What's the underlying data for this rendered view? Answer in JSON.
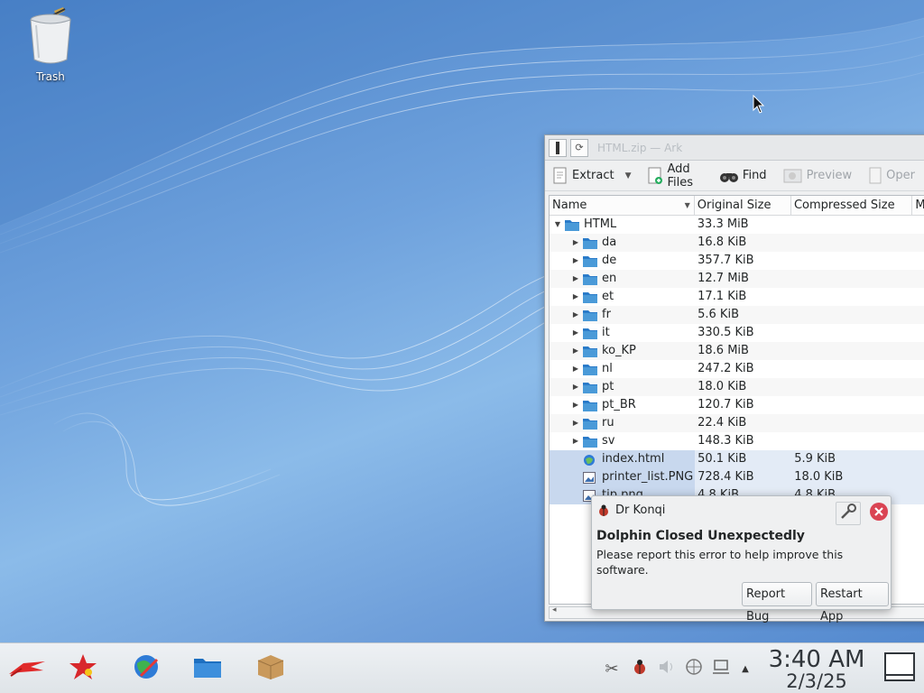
{
  "desktop": {
    "trash_label": "Trash"
  },
  "ark": {
    "title": "HTML.zip — Ark",
    "toolbar": {
      "extract": "Extract",
      "add_files": "Add Files",
      "find": "Find",
      "preview": "Preview",
      "open": "Oper"
    },
    "columns": [
      "Name",
      "Original Size",
      "Compressed Size",
      "M"
    ],
    "rows": [
      {
        "name": "HTML",
        "size": "33.3 MiB",
        "compressed": "",
        "mod": "",
        "type": "root"
      },
      {
        "name": "da",
        "size": "16.8 KiB",
        "compressed": "",
        "mod": "",
        "type": "folder"
      },
      {
        "name": "de",
        "size": "357.7 KiB",
        "compressed": "",
        "mod": "",
        "type": "folder"
      },
      {
        "name": "en",
        "size": "12.7 MiB",
        "compressed": "",
        "mod": "",
        "type": "folder"
      },
      {
        "name": "et",
        "size": "17.1 KiB",
        "compressed": "",
        "mod": "",
        "type": "folder"
      },
      {
        "name": "fr",
        "size": "5.6 KiB",
        "compressed": "",
        "mod": "",
        "type": "folder"
      },
      {
        "name": "it",
        "size": "330.5 KiB",
        "compressed": "",
        "mod": "",
        "type": "folder"
      },
      {
        "name": "ko_KP",
        "size": "18.6 MiB",
        "compressed": "",
        "mod": "",
        "type": "folder"
      },
      {
        "name": "nl",
        "size": "247.2 KiB",
        "compressed": "",
        "mod": "",
        "type": "folder"
      },
      {
        "name": "pt",
        "size": "18.0 KiB",
        "compressed": "",
        "mod": "",
        "type": "folder"
      },
      {
        "name": "pt_BR",
        "size": "120.7 KiB",
        "compressed": "",
        "mod": "",
        "type": "folder"
      },
      {
        "name": "ru",
        "size": "22.4 KiB",
        "compressed": "",
        "mod": "",
        "type": "folder"
      },
      {
        "name": "sv",
        "size": "148.3 KiB",
        "compressed": "",
        "mod": "",
        "type": "folder"
      },
      {
        "name": "index.html",
        "size": "50.1 KiB",
        "compressed": "5.9 KiB",
        "mod": "",
        "type": "html"
      },
      {
        "name": "printer_list.PNG",
        "size": "728.4 KiB",
        "compressed": "18.0 KiB",
        "mod": "",
        "type": "image"
      },
      {
        "name": "tip.png",
        "size": "4.8 KiB",
        "compressed": "4.8 KiB",
        "mod": "",
        "type": "image"
      }
    ]
  },
  "notification": {
    "app": "Dr Konqi",
    "title": "Dolphin Closed Unexpectedly",
    "body": "Please report this error to help improve this software.",
    "report_button": "Report Bug",
    "restart_button": "Restart App"
  },
  "taskbar": {
    "time": "3:40 AM",
    "date": "2/3/25"
  },
  "colors": {
    "accent": "#3daee9",
    "folder": "#4a9ad8",
    "close_red": "#da4453"
  }
}
